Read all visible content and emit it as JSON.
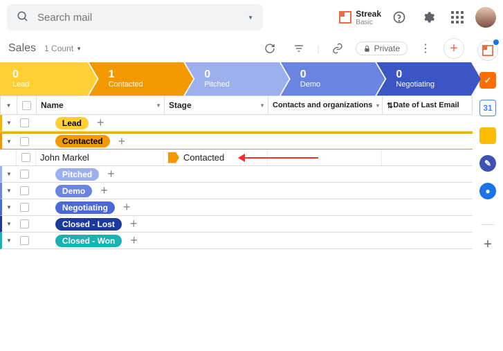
{
  "search": {
    "placeholder": "Search mail"
  },
  "brand": {
    "name": "Streak",
    "tier": "Basic"
  },
  "toolbar": {
    "heading": "Sales",
    "count": "1 Count",
    "private": "Private"
  },
  "funnel": [
    {
      "count": "0",
      "label": "Lead",
      "color": "#ffcf33"
    },
    {
      "count": "1",
      "label": "Contacted",
      "color": "#f29900"
    },
    {
      "count": "0",
      "label": "Pitched",
      "color": "#9bb0ec"
    },
    {
      "count": "0",
      "label": "Demo",
      "color": "#6a85e0"
    },
    {
      "count": "0",
      "label": "Negotiating",
      "color": "#3b56c4"
    }
  ],
  "columns": [
    "Name",
    "Stage",
    "Contacts and organizations",
    "Date of Last Email"
  ],
  "groups": [
    {
      "label": "Lead",
      "bg": "#ffcf33",
      "fg": "#000",
      "accent": "#f4b400",
      "rows": []
    },
    {
      "label": "Contacted",
      "bg": "#f29900",
      "fg": "#000",
      "accent": "#f29900",
      "rows": [
        {
          "name": "John Markel",
          "stage": "Contacted"
        }
      ]
    },
    {
      "label": "Pitched",
      "bg": "#9bb0ec",
      "fg": "#fff",
      "accent": "#9bb0ec",
      "rows": []
    },
    {
      "label": "Demo",
      "bg": "#6a85e0",
      "fg": "#fff",
      "accent": "#6a85e0",
      "rows": []
    },
    {
      "label": "Negotiating",
      "bg": "#4a68d8",
      "fg": "#fff",
      "accent": "#4a68d8",
      "rows": []
    },
    {
      "label": "Closed - Lost",
      "bg": "#1b3a9c",
      "fg": "#fff",
      "accent": "#1b3a9c",
      "rows": []
    },
    {
      "label": "Closed - Won",
      "bg": "#17b2b2",
      "fg": "#fff",
      "accent": "#17b2b2",
      "rows": []
    }
  ],
  "rail": {
    "streak_color": "#ea6d46",
    "items": [
      {
        "name": "tasks-icon",
        "bg": "#ff6d00",
        "glyph": "✓",
        "fg": "#fff"
      },
      {
        "name": "calendar-icon",
        "bg": "#fff",
        "glyph": "31",
        "fg": "#4285f4",
        "border": "1px solid #4285f4"
      },
      {
        "name": "keep-icon",
        "bg": "#fbbc04",
        "glyph": "",
        "fg": "#fff"
      },
      {
        "name": "tasks2-icon",
        "bg": "#3f51b5",
        "glyph": "✎",
        "fg": "#fff",
        "round": "50%"
      },
      {
        "name": "contacts-icon",
        "bg": "#1a73e8",
        "glyph": "●",
        "fg": "#fff",
        "round": "50%"
      }
    ]
  }
}
